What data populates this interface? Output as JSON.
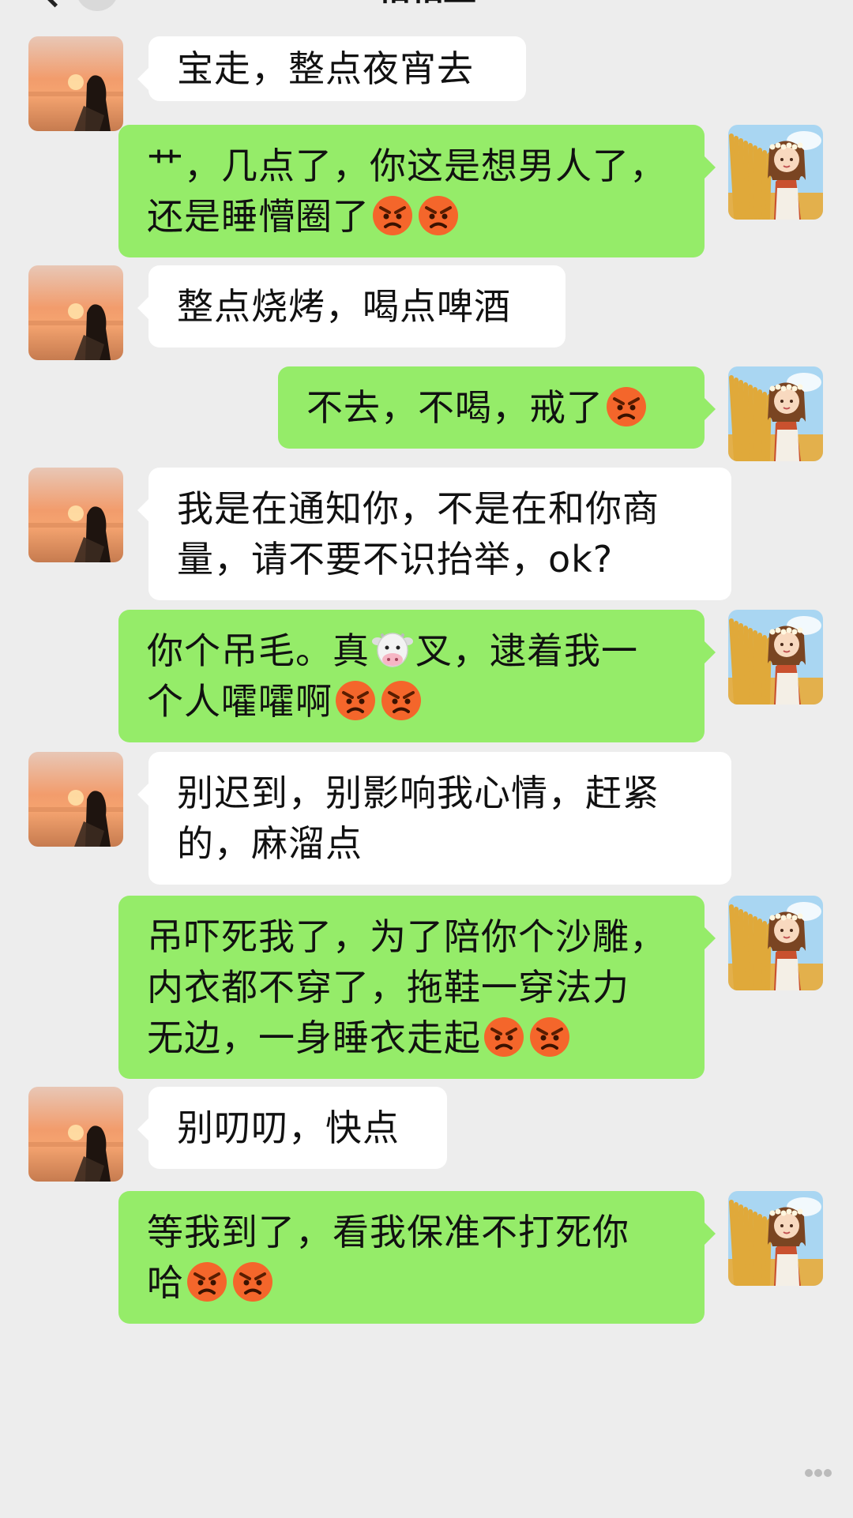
{
  "header": {
    "title": "相相互"
  },
  "icons": {
    "angry": "angry-face-emoji",
    "cow": "cow-face-emoji",
    "back": "chevron-left-icon"
  },
  "colors": {
    "background": "#ededed",
    "incoming_bubble": "#ffffff",
    "outgoing_bubble": "#95ec69"
  },
  "messages": [
    {
      "side": "in",
      "lines": [
        "宝走，整点夜宵去"
      ]
    },
    {
      "side": "out",
      "lines": [
        "艹，几点了，你这是想男人了，",
        "还是睡懵圈了{angry}{angry}"
      ]
    },
    {
      "side": "in",
      "lines": [
        "整点烧烤，喝点啤酒"
      ]
    },
    {
      "side": "out",
      "lines": [
        "不去，不喝，戒了{angry}"
      ]
    },
    {
      "side": "in",
      "lines": [
        "我是在通知你，不是在和你商",
        "量，请不要不识抬举，ok?"
      ]
    },
    {
      "side": "out",
      "lines": [
        "你个吊毛。真{cow}叉，逮着我一",
        "个人嚯嚯啊{angry}{angry}"
      ]
    },
    {
      "side": "in",
      "lines": [
        "别迟到，别影响我心情，赶紧",
        "的，麻溜点"
      ]
    },
    {
      "side": "out",
      "lines": [
        "吊吓死我了，为了陪你个沙雕，",
        "内衣都不穿了，拖鞋一穿法力",
        "无边，一身睡衣走起{angry}{angry}"
      ]
    },
    {
      "side": "in",
      "lines": [
        "别叨叨，快点"
      ]
    },
    {
      "side": "out",
      "lines": [
        "等我到了，看我保准不打死你",
        "哈{angry}{angry}"
      ]
    }
  ]
}
